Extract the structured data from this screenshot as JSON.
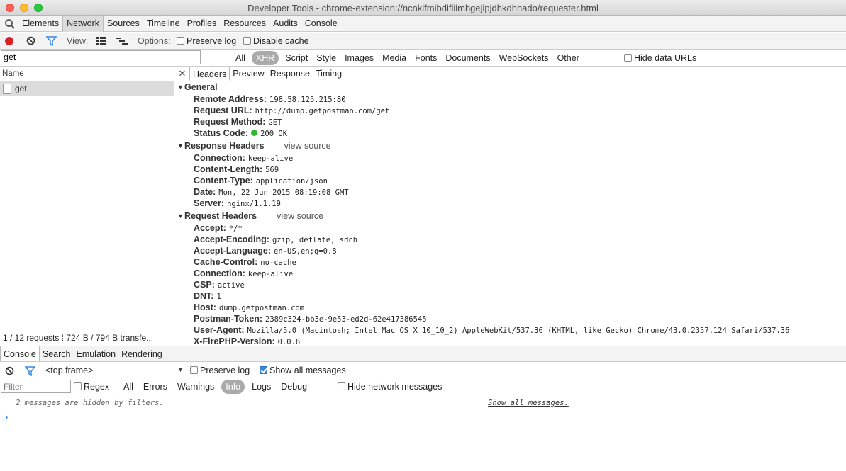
{
  "window": {
    "title": "Developer Tools - chrome-extension://ncnklfmibdifliimhgejlpjdhkdhhado/requester.html"
  },
  "panel_tabs": [
    "Elements",
    "Network",
    "Sources",
    "Timeline",
    "Profiles",
    "Resources",
    "Audits",
    "Console"
  ],
  "active_panel": "Network",
  "network_toolbar": {
    "view_label": "View:",
    "options_label": "Options:",
    "preserve_log": "Preserve log",
    "disable_cache": "Disable cache"
  },
  "filter": {
    "value": "get",
    "types": [
      "All",
      "XHR",
      "Script",
      "Style",
      "Images",
      "Media",
      "Fonts",
      "Documents",
      "WebSockets",
      "Other"
    ],
    "active_type": "XHR",
    "hide_data_urls": "Hide data URLs"
  },
  "requests": {
    "column_name": "Name",
    "rows": [
      {
        "name": "get"
      }
    ],
    "summary": "1 / 12 requests  ⁞  724 B / 794 B transfe..."
  },
  "detail_tabs": [
    "Headers",
    "Preview",
    "Response",
    "Timing"
  ],
  "general": {
    "title": "General",
    "items": [
      {
        "k": "Remote Address:",
        "v": "198.58.125.215:80"
      },
      {
        "k": "Request URL:",
        "v": "http://dump.getpostman.com/get"
      },
      {
        "k": "Request Method:",
        "v": "GET"
      },
      {
        "k": "Status Code:",
        "v": "200 OK"
      }
    ]
  },
  "response_headers": {
    "title": "Response Headers",
    "view_source": "view source",
    "items": [
      {
        "k": "Connection:",
        "v": "keep-alive"
      },
      {
        "k": "Content-Length:",
        "v": "569"
      },
      {
        "k": "Content-Type:",
        "v": "application/json"
      },
      {
        "k": "Date:",
        "v": "Mon, 22 Jun 2015 08:19:08 GMT"
      },
      {
        "k": "Server:",
        "v": "nginx/1.1.19"
      }
    ]
  },
  "request_headers": {
    "title": "Request Headers",
    "view_source": "view source",
    "items": [
      {
        "k": "Accept:",
        "v": "*/*"
      },
      {
        "k": "Accept-Encoding:",
        "v": "gzip, deflate, sdch"
      },
      {
        "k": "Accept-Language:",
        "v": "en-US,en;q=0.8"
      },
      {
        "k": "Cache-Control:",
        "v": "no-cache"
      },
      {
        "k": "Connection:",
        "v": "keep-alive"
      },
      {
        "k": "CSP:",
        "v": "active"
      },
      {
        "k": "DNT:",
        "v": "1"
      },
      {
        "k": "Host:",
        "v": "dump.getpostman.com"
      },
      {
        "k": "Postman-Token:",
        "v": "2389c324-bb3e-9e53-ed2d-62e417386545"
      },
      {
        "k": "User-Agent:",
        "v": "Mozilla/5.0 (Macintosh; Intel Mac OS X 10_10_2) AppleWebKit/537.36 (KHTML, like Gecko) Chrome/43.0.2357.124 Safari/537.36"
      },
      {
        "k": "X-FirePHP-Version:",
        "v": "0.0.6"
      }
    ]
  },
  "drawer": {
    "tabs": [
      "Console",
      "Search",
      "Emulation",
      "Rendering"
    ],
    "frame": "<top frame>",
    "preserve_log": "Preserve log",
    "show_all_messages": "Show all messages",
    "filter_placeholder": "Filter",
    "regex": "Regex",
    "levels": [
      "All",
      "Errors",
      "Warnings",
      "Info",
      "Logs",
      "Debug"
    ],
    "active_level": "Info",
    "hide_network": "Hide network messages",
    "hidden_msg": "2 messages are hidden by filters.",
    "show_all_link": "Show all messages.",
    "prompt": "›"
  },
  "colors": {
    "record": "#d92323",
    "status_ok": "#2fb82f",
    "accent": "#3b87e0"
  }
}
